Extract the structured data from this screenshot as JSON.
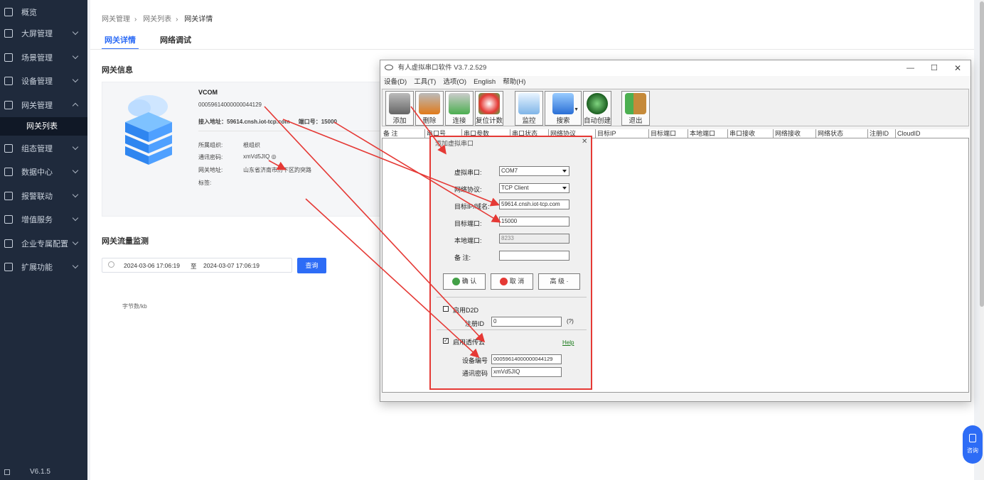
{
  "sidebar": {
    "items": [
      {
        "label": "概览",
        "icon": "overview-icon"
      },
      {
        "label": "大屏管理",
        "icon": "screen-icon"
      },
      {
        "label": "场景管理",
        "icon": "scene-icon"
      },
      {
        "label": "设备管理",
        "icon": "device-icon"
      },
      {
        "label": "网关管理",
        "icon": "gateway-icon"
      },
      {
        "label": "组态管理",
        "icon": "config-icon"
      },
      {
        "label": "数据中心",
        "icon": "data-icon"
      },
      {
        "label": "报警联动",
        "icon": "alarm-icon"
      },
      {
        "label": "增值服务",
        "icon": "vip-icon"
      },
      {
        "label": "企业专属配置",
        "icon": "enterprise-icon"
      },
      {
        "label": "扩展功能",
        "icon": "extend-icon"
      }
    ],
    "sub_item": "网关列表",
    "version": "V6.1.5"
  },
  "breadcrumb": [
    "网关管理",
    "网关列表",
    "网关详情"
  ],
  "tabs": [
    "网关详情",
    "网络调试"
  ],
  "gateway": {
    "section_title": "网关信息",
    "name": "VCOM",
    "sn": "00059614000000044129",
    "access_label": "接入地址：",
    "access": "59614.cnsh.iot-tcp.com",
    "port_label": "端口号：",
    "port": "15000",
    "fields": [
      {
        "label": "所属组织:",
        "value": "根组织"
      },
      {
        "label": "通讯密码:",
        "value": "xmVd5JIQ ◎"
      },
      {
        "label": "网关地址:",
        "value": "山东省济南市历下区趵突路"
      },
      {
        "label": "标签:",
        "value": ""
      }
    ]
  },
  "traffic": {
    "title": "网关流量监测",
    "start": "2024-03-06 17:06:19",
    "sep": "至",
    "end": "2024-03-07 17:06:19",
    "query": "查询",
    "ylabel": "字节数/kb"
  },
  "fab_label": "咨询",
  "vcom": {
    "title": "有人虚拟串口软件 V3.7.2.529",
    "menu": [
      "设备(D)",
      "工具(T)",
      "选项(O)",
      "English",
      "帮助(H)"
    ],
    "toolbar": [
      "添加",
      "删除",
      "连接",
      "复位计数",
      "监控",
      "搜索",
      "自动创建",
      "退出"
    ],
    "columns": [
      "备 注",
      "串口号",
      "串口参数",
      "串口状态",
      "网络协议",
      "目标IP",
      "目标端口",
      "本地端口",
      "串口接收",
      "网络接收",
      "网络状态",
      "注册ID",
      "CloudID"
    ]
  },
  "dialog": {
    "title": "添加虚拟串口",
    "labels": [
      "虚拟串口:",
      "网络协议:",
      "目标IP/域名:",
      "目标端口:",
      "本地端口:",
      "备 注:"
    ],
    "values": [
      "COM7",
      "TCP Client",
      "59614.cnsh.iot-tcp.com",
      "15000",
      "8233",
      ""
    ],
    "ok": "确 认",
    "cancel": "取 消",
    "advanced": "高 级 ·",
    "d2d": "启用D2D",
    "reg_label": "注册ID",
    "reg_value": "0",
    "reg_hint": "(?)",
    "cloud": "启用透传云",
    "help": "Help",
    "dev_label": "设备编号",
    "dev_value": "00059614000000044129",
    "pwd_label": "通讯密码",
    "pwd_value": "xmVd5JIQ"
  },
  "colors": {
    "accent": "#2d6cf6",
    "sidebar": "#1f2a3c",
    "annotation": "#e53935"
  }
}
